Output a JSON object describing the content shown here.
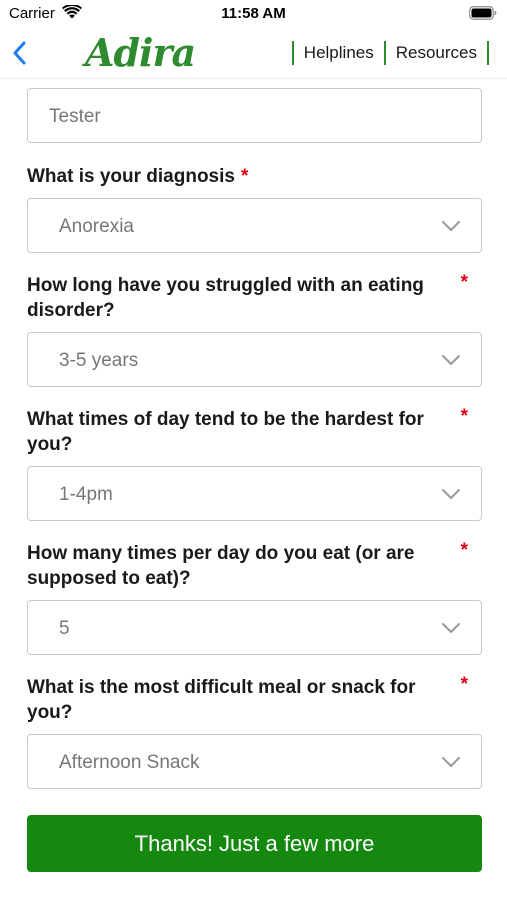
{
  "status_bar": {
    "carrier": "Carrier",
    "time": "11:58 AM"
  },
  "nav": {
    "logo": "Adira",
    "links": [
      "Helplines",
      "Resources"
    ],
    "accent_color": "#2e8b2e"
  },
  "form": {
    "name_value": "Tester",
    "questions": [
      {
        "label": "What is your diagnosis",
        "value": "Anorexia"
      },
      {
        "label": "How long have you struggled with an eating disorder?",
        "value": "3-5 years"
      },
      {
        "label": "What times of day tend to be the hardest for you?",
        "value": "1-4pm"
      },
      {
        "label": "How many times per day do you eat (or are supposed to eat)?",
        "value": "5"
      },
      {
        "label": "What is the most difficult meal or snack for you?",
        "value": "Afternoon Snack"
      }
    ],
    "required_marker": "*"
  },
  "submit_button": {
    "label": "Thanks! Just a few more",
    "color": "#14880f"
  }
}
